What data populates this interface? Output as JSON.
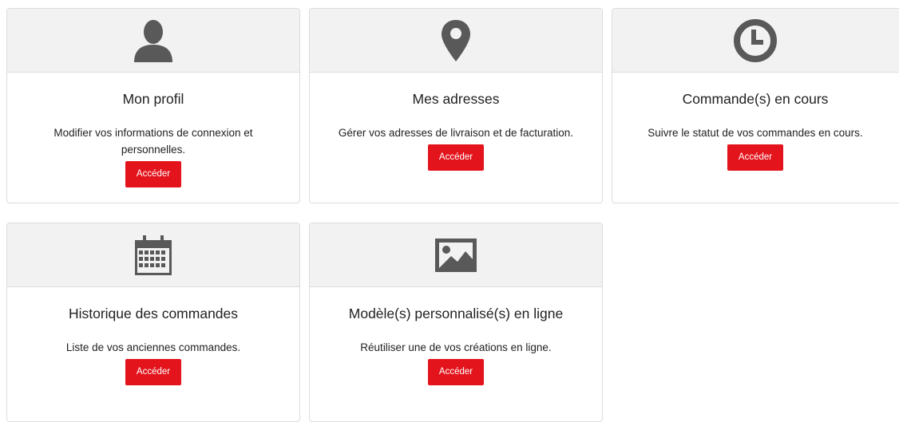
{
  "colors": {
    "icon": "#595959",
    "button": "#e3141c",
    "header_bg": "#f2f2f2"
  },
  "cards": [
    {
      "icon": "user-icon",
      "title": "Mon profil",
      "description": "Modifier vos informations de connexion et personnelles.",
      "button_label": "Accéder"
    },
    {
      "icon": "map-marker-icon",
      "title": "Mes adresses",
      "description": "Gérer vos adresses de livraison et de facturation.",
      "button_label": "Accéder"
    },
    {
      "icon": "clock-icon",
      "title": "Commande(s) en cours",
      "description": "Suivre le statut de vos commandes en cours.",
      "button_label": "Accéder"
    },
    {
      "icon": "calendar-icon",
      "title": "Historique des commandes",
      "description": "Liste de vos anciennes commandes.",
      "button_label": "Accéder"
    },
    {
      "icon": "image-icon",
      "title": "Modèle(s) personnalisé(s) en ligne",
      "description": "Réutiliser une de vos créations en ligne.",
      "button_label": "Accéder"
    }
  ]
}
